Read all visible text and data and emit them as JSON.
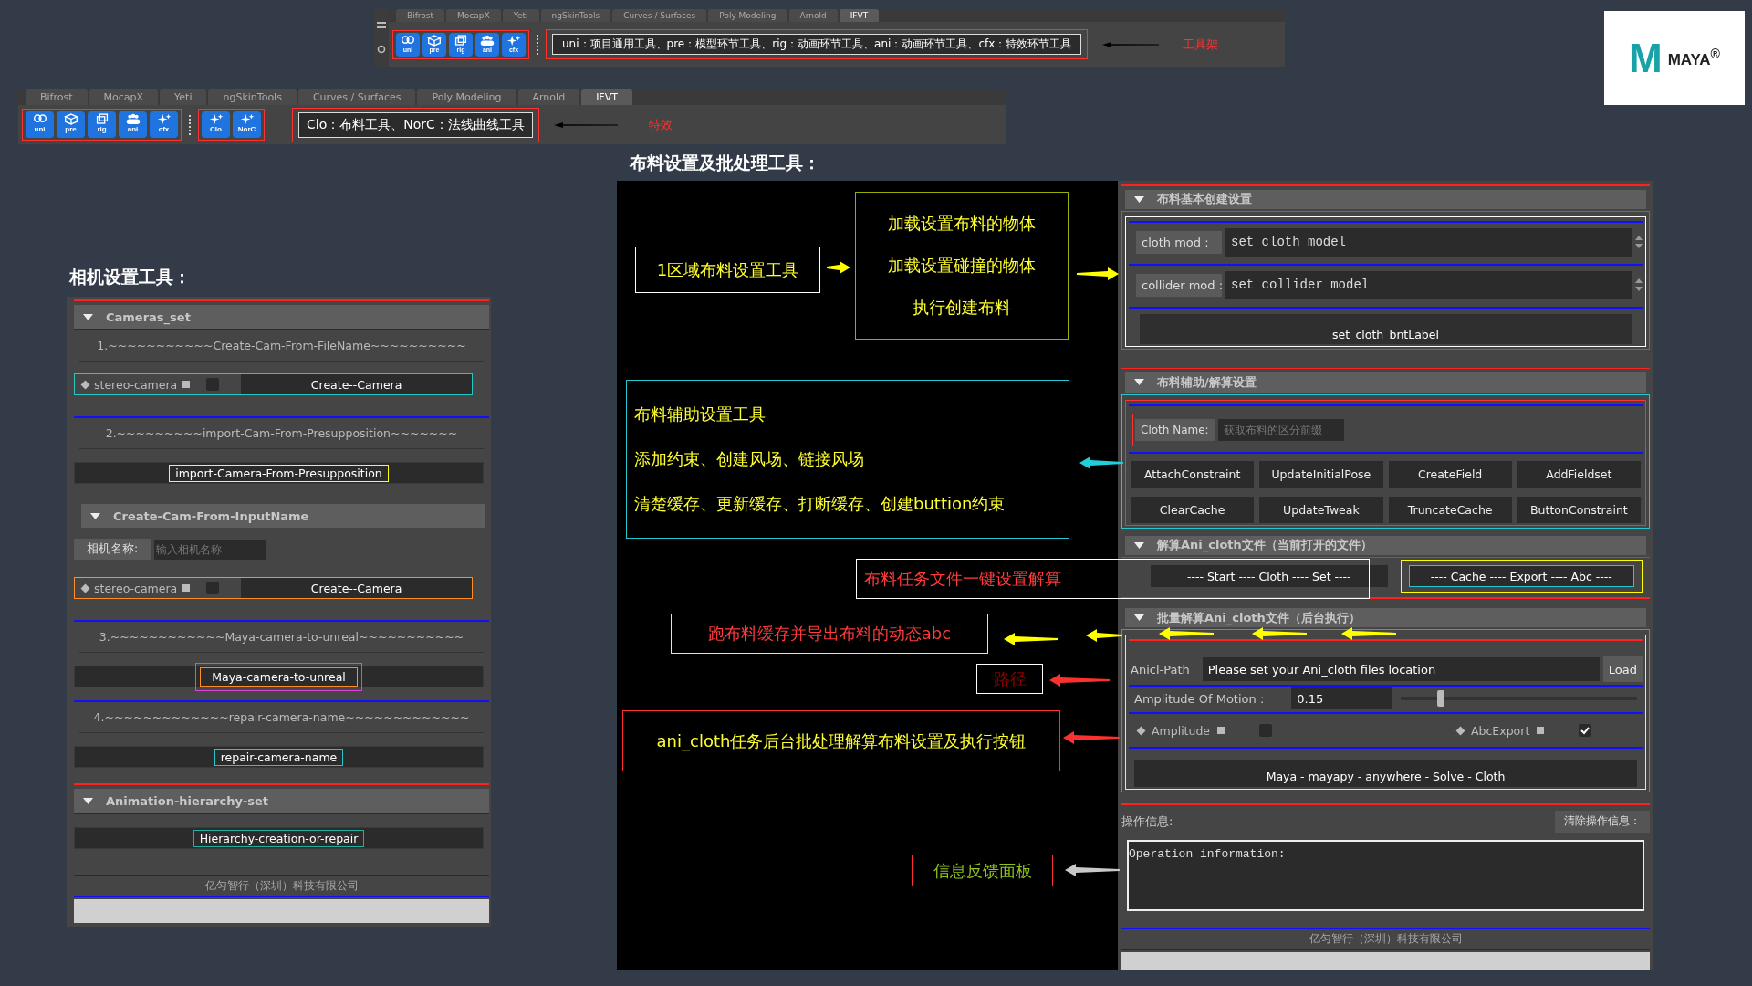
{
  "toolbar_shelf": {
    "tabs": [
      {
        "label": "Bifrost",
        "selected": false
      },
      {
        "label": "MocapX",
        "selected": false
      },
      {
        "label": "Yeti",
        "selected": false
      },
      {
        "label": "ngSkinTools",
        "selected": false
      },
      {
        "label": "Curves / Surfaces",
        "selected": false
      },
      {
        "label": "Poly Modeling",
        "selected": false
      },
      {
        "label": "Arnold",
        "selected": false
      },
      {
        "label": "IFVT",
        "selected": true
      }
    ],
    "buttons": [
      "uni",
      "pre",
      "rig",
      "ani",
      "cfx"
    ],
    "description": "uni：项目通用工具、pre：模型环节工具、rig：动画环节工具、ani：动画环节工具、cfx：特效环节工具",
    "callout": "工具架"
  },
  "effects_shelf": {
    "tabs": [
      {
        "label": "Bifrost",
        "selected": false
      },
      {
        "label": "MocapX",
        "selected": false
      },
      {
        "label": "Yeti",
        "selected": false
      },
      {
        "label": "ngSkinTools",
        "selected": false
      },
      {
        "label": "Curves / Surfaces",
        "selected": false
      },
      {
        "label": "Poly Modeling",
        "selected": false
      },
      {
        "label": "Arnold",
        "selected": false
      },
      {
        "label": "IFVT",
        "selected": true
      }
    ],
    "buttons": [
      "uni",
      "pre",
      "rig",
      "ani",
      "cfx"
    ],
    "effect_buttons": [
      "Clo",
      "NorC"
    ],
    "description": "Clo：布料工具、NorC：法线曲线工具",
    "callout": "特效"
  },
  "logo": {
    "mark": "M",
    "name": "MAYA$^{®}$"
  },
  "camera_tool": {
    "title": "相机设置工具：",
    "sections": [
      {
        "header": "Cameras_set",
        "expanded": true,
        "items": [
          {
            "kind": "rule",
            "color": "#1010ff"
          },
          {
            "kind": "caption",
            "text": "1.~~~~~~~~~~~Create-Cam-From-FileName~~~~~~~~~~"
          },
          {
            "kind": "camera",
            "option": "stereo-camera",
            "checked": false,
            "button": "Create--Camera",
            "color": "#22c8c8"
          },
          {
            "kind": "rule",
            "color": "#1010ff"
          },
          {
            "kind": "caption",
            "text": "2.~~~~~~~~~import-Cam-From-Presupposition~~~~~~~"
          },
          {
            "kind": "button",
            "text": "import-Camera-From-Presupposition",
            "color": "#ffff00"
          },
          {
            "kind": "subheader",
            "text": "Create-Cam-From-InputName",
            "expanded": true
          },
          {
            "kind": "name",
            "label": "相机名称:",
            "placeholder": "输入相机名称"
          },
          {
            "kind": "camera",
            "option": "stereo-camera",
            "checked": false,
            "button": "Create--Camera",
            "color": "#ff8c28"
          },
          {
            "kind": "rule",
            "color": "#1010ff"
          },
          {
            "kind": "caption",
            "text": "3.~~~~~~~~~~~~Maya-camera-to-unreal~~~~~~~~~~~"
          },
          {
            "kind": "framed",
            "text": "Maya-camera-to-unreal",
            "color": "#ff8c28"
          },
          {
            "kind": "rule",
            "color": "#1010ff"
          },
          {
            "kind": "caption",
            "text": "4.~~~~~~~~~~~~~repair-camera-name~~~~~~~~~~~~~"
          },
          {
            "kind": "button",
            "text": "repair-camera-name",
            "color": "#22c8c8"
          }
        ]
      },
      {
        "header": "Animation-hierarchy-set",
        "expanded": true,
        "items": [
          {
            "kind": "rule",
            "color": "#1010ff"
          },
          {
            "kind": "button",
            "text": "Hierarchy-creation-or-repair",
            "color": "#20b0a0"
          }
        ]
      }
    ],
    "footer": "亿匀智行（深圳）科技有限公司"
  },
  "cloth_tool": {
    "title": "布料设置及批处理工具：",
    "basic": {
      "header": "布料基本创建设置",
      "expanded": true,
      "fields": [
        {
          "label": "cloth mod :",
          "value": "set cloth model"
        },
        {
          "label": "collider mod :",
          "value": "set collider model"
        }
      ],
      "button": "set_cloth_bntLabel"
    },
    "assist": {
      "header": "布料辅助/解算设置",
      "expanded": true,
      "name_label": "Cloth Name:",
      "name_placeholder": "获取布料的区分前缀",
      "buttons": [
        "AttachConstraint",
        "UpdateInitialPose",
        "CreateField",
        "AddFieldset",
        "ClearCache",
        "UpdateTweak",
        "TruncateCache",
        "ButtonConstraint"
      ]
    },
    "solve": {
      "header": "解算Ani_cloth文件（当前打开的文件）",
      "expanded": true,
      "buttons": [
        "---- Start ---- Cloth ---- Set ----",
        "---- Cache ---- Export ---- Abc ----"
      ]
    },
    "batch": {
      "header": "批量解算Ani_cloth文件（后台执行）",
      "expanded": true,
      "path_label": "Anicl-Path",
      "path_value": "Please set your Ani_cloth files location",
      "load": "Load",
      "slider_label": "Amplitude Of Motion :",
      "slider_value": "0.15",
      "level": 0.17,
      "options": [
        {
          "label": "Amplitude",
          "checked": false
        },
        {
          "label": "AbcExport",
          "checked": true
        }
      ],
      "run": "Maya - mayapy - anywhere - Solve - Cloth"
    },
    "log": {
      "label": "操作信息:",
      "clear": "清除操作信息：",
      "text": "Operation information:"
    },
    "footer": "亿匀智行（深圳）科技有限公司"
  },
  "annotations": [
    {
      "kind": "tip",
      "color": "#ffffff",
      "lines": [
        "1区域布料设置工具"
      ]
    },
    {
      "kind": "tip",
      "color": "#9aad00",
      "lines": [
        "加载设置布料的物体",
        "加载设置碰撞的物体",
        "执行创建布料"
      ]
    },
    {
      "kind": "tip",
      "color": "#20c8d0",
      "lines": [
        "布料辅助设置工具",
        "添加约束、创建风场、链接风场",
        "清楚缓存、更新缓存、打断缓存、创建buttion约束"
      ]
    },
    {
      "kind": "warning",
      "color": "#ffffff",
      "lines": [
        "布料任务文件一键设置解算"
      ]
    },
    {
      "kind": "warning",
      "color": "#ffff00",
      "lines": [
        "跑布料缓存并导出布料的动态abc"
      ]
    },
    {
      "kind": "path",
      "color": "#ffffff",
      "lines": [
        "路径"
      ]
    },
    {
      "kind": "tip",
      "color": "#ff3030",
      "lines": [
        "ani_cloth任务后台批处理解算布料设置及执行按钮"
      ]
    },
    {
      "kind": "feedback",
      "color": "#ff3030",
      "lines": [
        "信息反馈面板"
      ]
    }
  ]
}
